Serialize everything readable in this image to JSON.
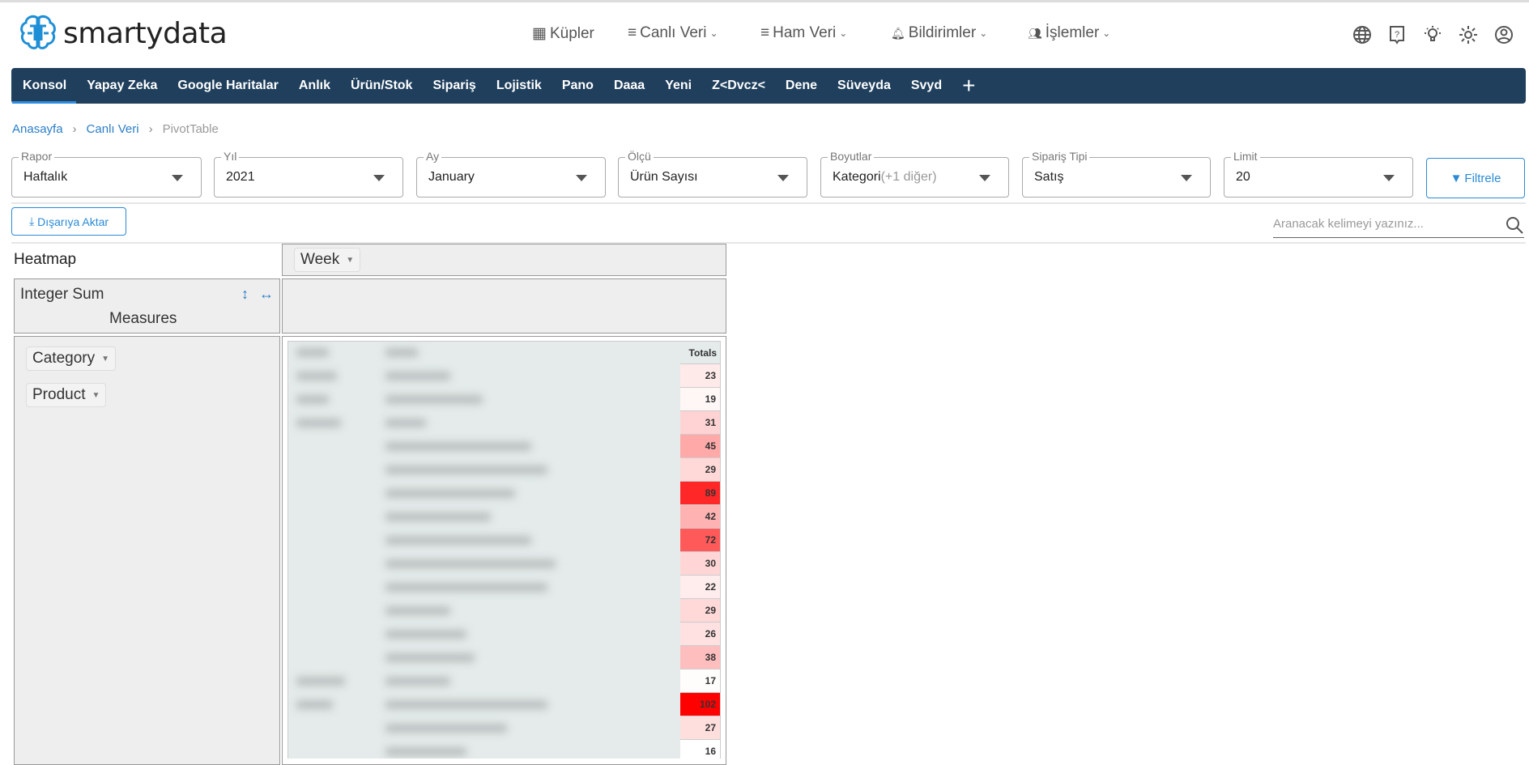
{
  "header": {
    "brand_a": "smarty",
    "brand_b": "data",
    "menu": [
      {
        "label": "Küpler",
        "icon": "cubes-icon",
        "dropdown": false
      },
      {
        "label": "Canlı Veri",
        "icon": "list-icon",
        "dropdown": true
      },
      {
        "label": "Ham Veri",
        "icon": "list-icon",
        "dropdown": true
      },
      {
        "label": "Bildirimler",
        "icon": "bell-icon",
        "dropdown": true
      },
      {
        "label": "İşlemler",
        "icon": "users-icon",
        "dropdown": true
      }
    ],
    "right_icons": [
      "globe-icon",
      "help-icon",
      "lightbulb-icon",
      "gear-icon",
      "user-circle-icon"
    ]
  },
  "tabs": [
    "Konsol",
    "Yapay Zeka",
    "Google Haritalar",
    "Anlık",
    "Ürün/Stok",
    "Sipariş",
    "Lojistik",
    "Pano",
    "Daaa",
    "Yeni",
    "Z<Dvcz<",
    "Dene",
    "Süveyda",
    "Svyd"
  ],
  "active_tab": "Konsol",
  "breadcrumb": [
    "Anasayfa",
    "Canlı Veri",
    "PivotTable"
  ],
  "filters": [
    {
      "label": "Rapor",
      "value": "Haftalık"
    },
    {
      "label": "Yıl",
      "value": "2021"
    },
    {
      "label": "Ay",
      "value": "January"
    },
    {
      "label": "Ölçü",
      "value": "Ürün Sayısı"
    },
    {
      "label": "Boyutlar",
      "value": "Kategori",
      "extra": "(+1 diğer)"
    },
    {
      "label": "Sipariş Tipi",
      "value": "Satış"
    },
    {
      "label": "Limit",
      "value": "20"
    }
  ],
  "filter_button": "Filtrele",
  "export_button": "Dışarıya Aktar",
  "search_placeholder": "Aranacak kelimeyi yazınız...",
  "pivot": {
    "renderer": "Heatmap",
    "col_field": "Week",
    "aggregator": "Integer Sum",
    "measures": "Measures",
    "row_fields": [
      "Category",
      "Product"
    ],
    "totals_header": "Totals",
    "totals": [
      23,
      19,
      31,
      45,
      29,
      89,
      42,
      72,
      30,
      22,
      29,
      26,
      38,
      17,
      102,
      27,
      16
    ],
    "heat_colors": {
      "low": "#ffffff",
      "high": "#ff0000"
    }
  }
}
